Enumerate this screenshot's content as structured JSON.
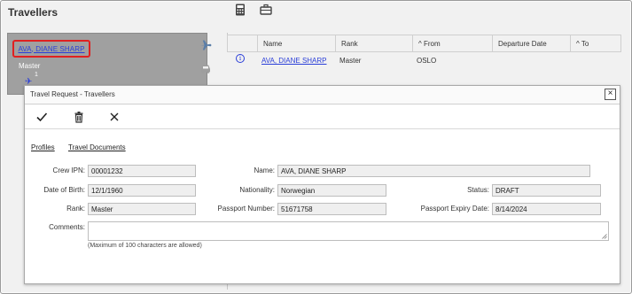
{
  "window": {
    "title": "Travellers"
  },
  "toolbar": {
    "icons": [
      "calculator-icon",
      "briefcase-icon"
    ]
  },
  "card": {
    "name": "AVA, DIANE SHARP",
    "rank": "Master",
    "count": "1"
  },
  "grid": {
    "headers": [
      {
        "label": "Name"
      },
      {
        "label": "Rank"
      },
      {
        "label": "^ From"
      },
      {
        "label": "Departure Date"
      },
      {
        "label": "^ To"
      }
    ],
    "rows": [
      {
        "name": "AVA, DIANE SHARP",
        "rank": "Master",
        "from": "OSLO",
        "departure": "",
        "to": ""
      }
    ]
  },
  "dialog": {
    "title": "Travel Request - Travellers",
    "close": "×",
    "tabs": [
      "Profiles",
      "Travel Documents"
    ],
    "labels": {
      "crew_ipn": "Crew IPN:",
      "name": "Name:",
      "dob": "Date of Birth:",
      "nationality": "Nationality:",
      "status": "Status:",
      "rank": "Rank:",
      "passport_number": "Passport Number:",
      "passport_expiry": "Passport Expiry Date:",
      "comments": "Comments:"
    },
    "values": {
      "crew_ipn": "00001232",
      "name": "AVA, DIANE SHARP",
      "dob": "12/1/1960",
      "nationality": "Norwegian",
      "status": "DRAFT",
      "rank": "Master",
      "passport_number": "51671758",
      "passport_expiry": "8/14/2024",
      "comments": ""
    },
    "comments_note": "(Maximum of 100 characters are allowed)"
  },
  "colors": {
    "link": "#2a3ed8",
    "highlight": "#e02020",
    "panel": "#a0a0a0"
  }
}
